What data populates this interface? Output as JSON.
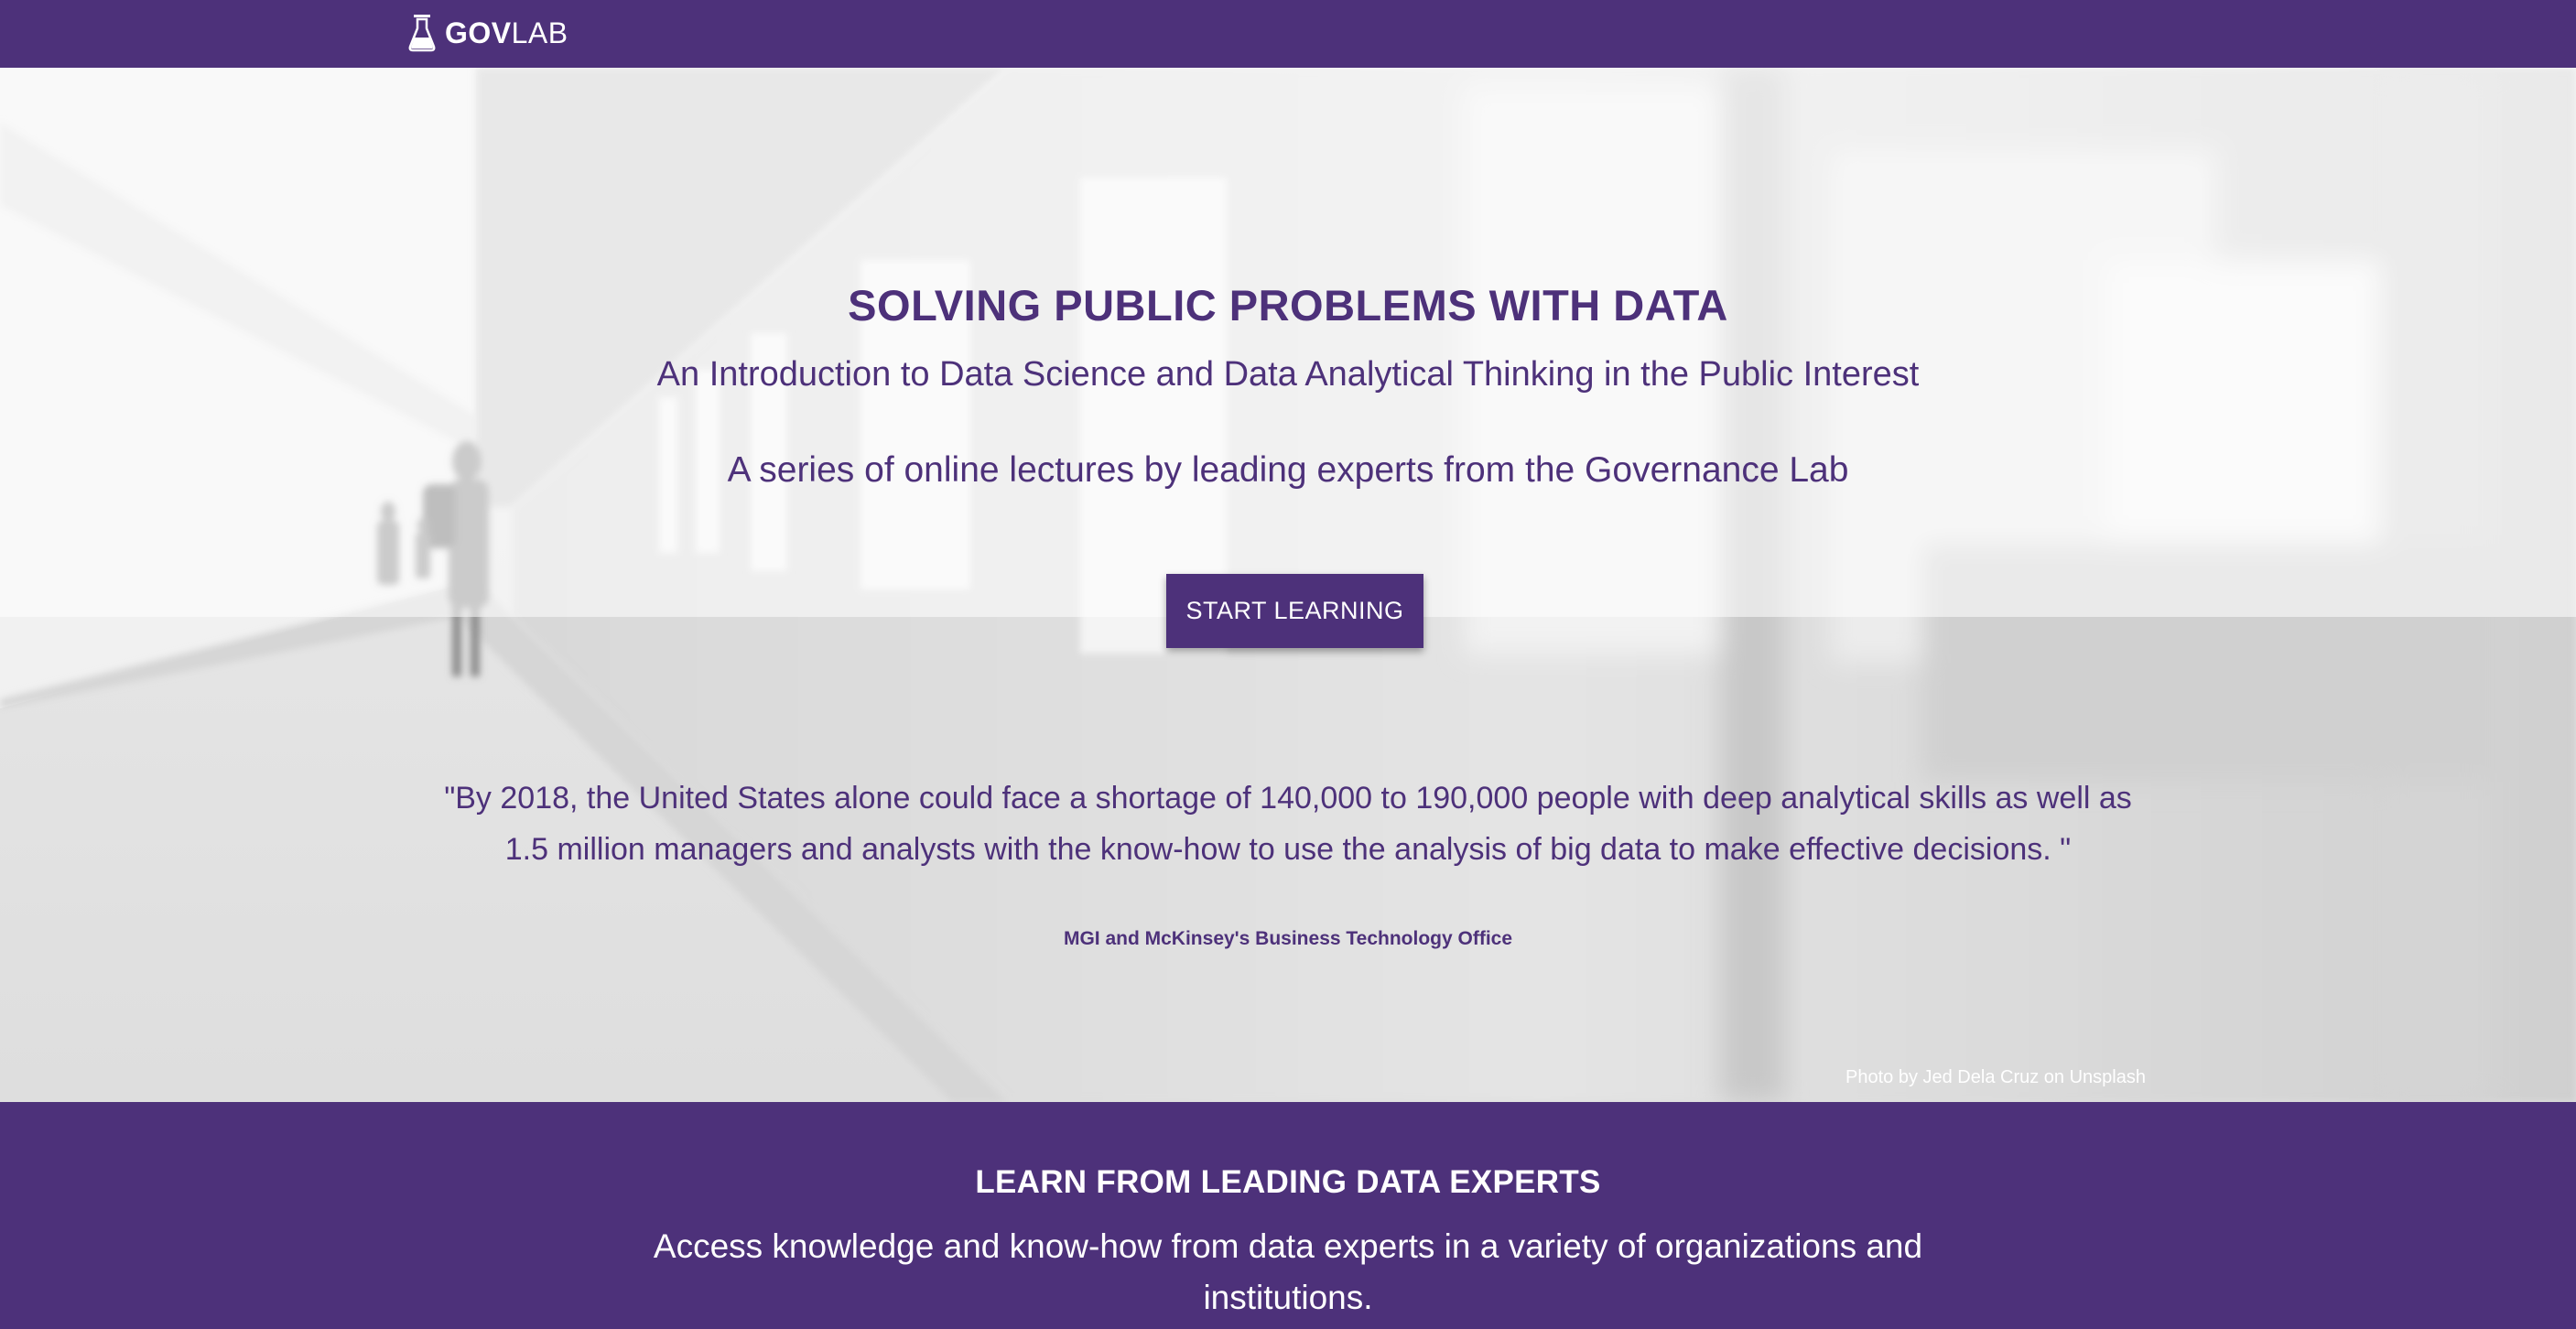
{
  "navbar": {
    "brand_bold": "GOV",
    "brand_light": "LAB",
    "logo_icon": "flask-icon",
    "background": "#4d317a"
  },
  "hero": {
    "title": "SOLVING PUBLIC PROBLEMS WITH DATA",
    "subtitle": "An Introduction to Data Science and Data Analytical Thinking in the Public Interest",
    "series": "A series of online lectures by leading experts from the Governance Lab",
    "cta_label": "START LEARNING",
    "quote": "\"By 2018, the United States alone could face a shortage of 140,000 to 190,000 people with deep analytical skills as well as 1.5 million managers and analysts with the know-how to use the analysis of big data to make effective decisions. \"",
    "quote_source": "MGI and McKinsey's Business Technology Office",
    "photo_credit": "Photo by Jed Dela Cruz on Unsplash",
    "accent": "#4d317a"
  },
  "experts_section": {
    "title": "LEARN FROM LEADING DATA EXPERTS",
    "text": "Access knowledge and know-how from data experts in a variety of organizations and institutions."
  }
}
